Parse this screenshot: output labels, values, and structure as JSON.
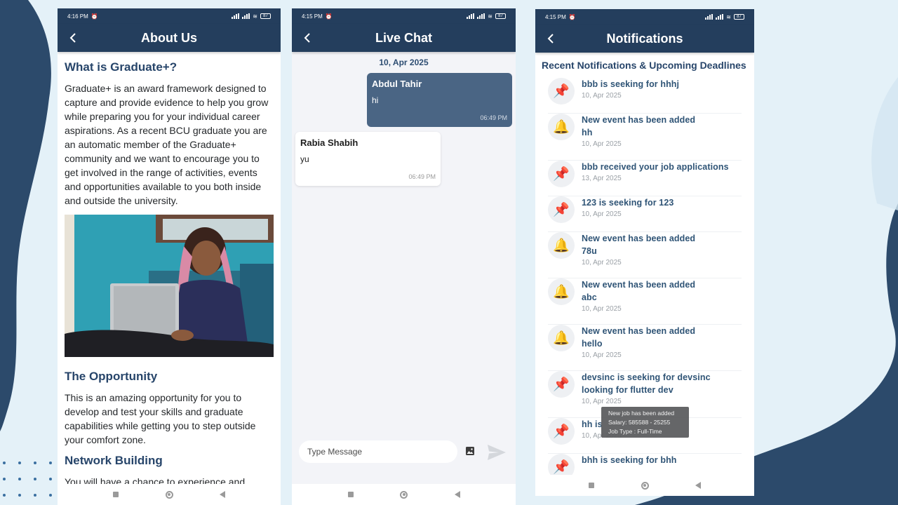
{
  "about": {
    "status_time": "4:16 PM",
    "battery": "87",
    "title": "About Us",
    "h1": "What is Graduate+?",
    "p1": "Graduate+ is an award framework designed to capture and provide evidence to help you grow while preparing you for your individual career aspirations. As a recent BCU graduate you are an automatic member of the Graduate+ community and we want to encourage you to get involved in the range of activities, events and opportunities available to you both inside and outside the university.",
    "h2": "The Opportunity",
    "p2": "This is an amazing opportunity for you to develop and test your skills and graduate capabilities while getting you to step outside your comfort zone.",
    "h3": "Network Building",
    "p3": "You will have a chance to experience and"
  },
  "chat": {
    "status_time": "4:15 PM",
    "battery": "87",
    "title": "Live Chat",
    "date": "10, Apr 2025",
    "messages": [
      {
        "sender": "Abdul Tahir",
        "text": "hi",
        "time": "06:49 PM"
      },
      {
        "sender": "Rabia Shabih",
        "text": "yu",
        "time": "06:49 PM"
      }
    ],
    "input_placeholder": "Type Message"
  },
  "notifications": {
    "status_time": "4:15 PM",
    "battery": "87",
    "title": "Notifications",
    "heading": "Recent Notifications & Upcoming Deadlines",
    "items": [
      {
        "icon": "pushpin-icon",
        "glyph": "📌",
        "title": "bbb is seeking for hhhj",
        "date": "10, Apr 2025"
      },
      {
        "icon": "bell-icon",
        "glyph": "🔔",
        "title": "New event has been added\nhh",
        "date": "10, Apr 2025"
      },
      {
        "icon": "pushpin-icon",
        "glyph": "📌",
        "title": "bbb received your job applications",
        "date": "13, Apr 2025"
      },
      {
        "icon": "pushpin-icon",
        "glyph": "📌",
        "title": "123 is seeking for 123",
        "date": "10, Apr 2025"
      },
      {
        "icon": "bell-icon",
        "glyph": "🔔",
        "title": "New event has been added\n78u",
        "date": "10, Apr 2025"
      },
      {
        "icon": "bell-icon",
        "glyph": "🔔",
        "title": "New event has been added\nabc",
        "date": "10, Apr 2025"
      },
      {
        "icon": "bell-icon",
        "glyph": "🔔",
        "title": "New event has been added\nhello",
        "date": "10, Apr 2025"
      },
      {
        "icon": "pushpin-icon",
        "glyph": "📌",
        "title": "devsinc is seeking for devsinc\nlooking for flutter dev",
        "date": "10, Apr 2025"
      },
      {
        "icon": "pushpin-icon",
        "glyph": "📌",
        "title": "hh is",
        "date": "10, Apr 2025"
      },
      {
        "icon": "pushpin-icon",
        "glyph": "📌",
        "title": "bhh is seeking for bhh",
        "date": ""
      }
    ],
    "tooltip": {
      "line1": "New job has been added",
      "line2": "Salary: 585588 - 25255",
      "line3": "Job Type : Full-Time"
    }
  },
  "colors": {
    "appbar": "#243e5d",
    "heading": "#27456a",
    "outgoing_bubble": "#4a6584",
    "background": "#e4f1f8",
    "decor_dark": "#2c4a6b"
  }
}
